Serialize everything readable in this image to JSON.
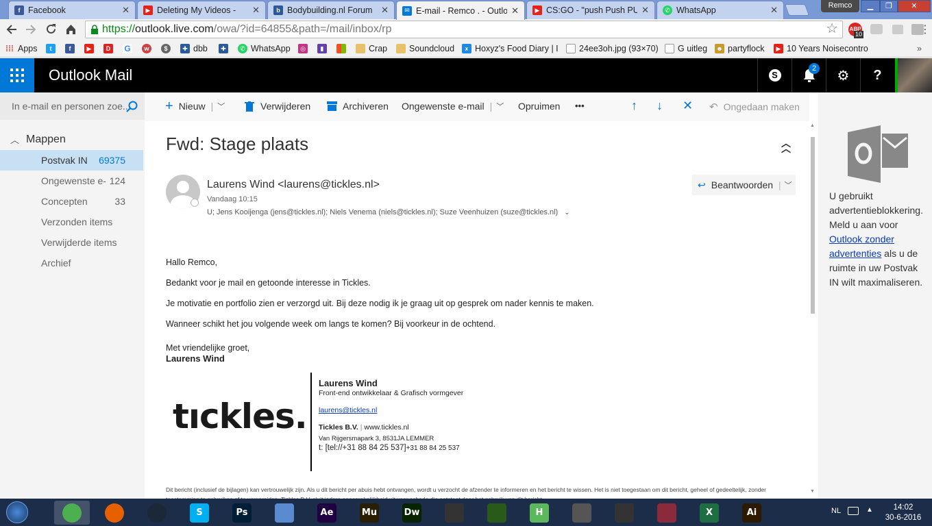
{
  "browser": {
    "tabs": [
      {
        "title": "Facebook",
        "favicon": "facebook-icon",
        "color": "#3b5998",
        "active": false
      },
      {
        "title": "Deleting My Videos -",
        "favicon": "youtube-icon",
        "color": "#e62117",
        "active": false
      },
      {
        "title": "Bodybuilding.nl Forum",
        "favicon": "forum-icon",
        "color": "#2b5a9a",
        "active": false
      },
      {
        "title": "E-mail - Remco . - Outlo",
        "favicon": "outlook-mail-icon",
        "color": "#0078d7",
        "active": true
      },
      {
        "title": "CS:GO - \"push Push PUS",
        "favicon": "youtube-icon",
        "color": "#e62117",
        "active": false
      },
      {
        "title": "WhatsApp",
        "favicon": "whatsapp-icon",
        "color": "#25d366",
        "active": false
      }
    ],
    "profile_name": "Remco",
    "url": {
      "scheme": "https://",
      "host": "outlook.live.com",
      "path": "/owa/?id=64855&path=/mail/inbox/rp"
    },
    "extension_badge": "10",
    "bookmarks": [
      {
        "label": "Apps",
        "icon": "apps-grid-icon",
        "color": "#d44"
      },
      {
        "label": "",
        "icon": "twitter-icon",
        "color": "#1da1f2"
      },
      {
        "label": "",
        "icon": "facebook-icon",
        "color": "#3b5998"
      },
      {
        "label": "",
        "icon": "youtube-icon",
        "color": "#e62117"
      },
      {
        "label": "",
        "icon": "dumpert-icon",
        "color": "#d22"
      },
      {
        "label": "",
        "icon": "google-icon",
        "color": "#4285f4"
      },
      {
        "label": "",
        "icon": "webrtc-icon",
        "color": "#c44"
      },
      {
        "label": "",
        "icon": "bookmark-icon",
        "color": "#666"
      },
      {
        "label": "dbb",
        "icon": "dbb-icon",
        "color": "#2b5a9a"
      },
      {
        "label": "",
        "icon": "dbb2-icon",
        "color": "#2b5a9a"
      },
      {
        "label": "WhatsApp",
        "icon": "whatsapp-icon",
        "color": "#25d366"
      },
      {
        "label": "",
        "icon": "instagram-icon",
        "color": "#c13584"
      },
      {
        "label": "",
        "icon": "twitch-icon",
        "color": "#6441a5"
      },
      {
        "label": "",
        "icon": "microsoft-icon",
        "color": "#f25022"
      },
      {
        "label": "Crap",
        "icon": "folder-icon",
        "color": "#e8c26a"
      },
      {
        "label": "Soundcloud",
        "icon": "folder-icon",
        "color": "#e8c26a"
      },
      {
        "label": "Hoxyz's Food Diary | I",
        "icon": "excel-icon",
        "color": "#1e88e5"
      },
      {
        "label": "24ee3oh.jpg (93×70)",
        "icon": "page-icon",
        "color": "#999"
      },
      {
        "label": "G uitleg",
        "icon": "page-icon",
        "color": "#999"
      },
      {
        "label": "partyflock",
        "icon": "partyflock-icon",
        "color": "#c99a2e"
      },
      {
        "label": "10 Years Noisecontro",
        "icon": "youtube-icon",
        "color": "#e62117"
      }
    ]
  },
  "outlook": {
    "app_title": "Outlook Mail",
    "notification_count": "2",
    "search_placeholder": "In e-mail en personen zoe...",
    "folders_header": "Mappen",
    "folders": [
      {
        "name": "Postvak IN",
        "count": "69375",
        "selected": true
      },
      {
        "name": "Ongewenste e-",
        "count": "124",
        "selected": false
      },
      {
        "name": "Concepten",
        "count": "33",
        "selected": false
      },
      {
        "name": "Verzonden items",
        "count": "",
        "selected": false
      },
      {
        "name": "Verwijderde items",
        "count": "",
        "selected": false
      },
      {
        "name": "Archief",
        "count": "",
        "selected": false
      }
    ],
    "commands": {
      "new": "Nieuw",
      "delete": "Verwijderen",
      "archive": "Archiveren",
      "junk": "Ongewenste e-mail",
      "sweep": "Opruimen",
      "more": "•••",
      "undo": "Ongedaan maken"
    },
    "message": {
      "subject": "Fwd: Stage plaats",
      "sender": "Laurens Wind <laurens@tickles.nl>",
      "date": "Vandaag 10:15",
      "recipients": "U; Jens Kooijenga (jens@tickles.nl); Niels Venema (niels@tickles.nl); Suze Veenhuizen (suze@tickles.nl)",
      "reply": "Beantwoorden",
      "body": [
        "Hallo Remco,",
        "Bedankt voor je mail en getoonde interesse in Tickles.",
        "Je motivatie en portfolio zien er verzorgd uit. Bij deze nodig ik je graag uit op gesprek om nader kennis te maken.",
        "Wanneer schikt het jou volgende week om langs te komen? Bij voorkeur in de ochtend."
      ],
      "closing": "Met vriendelijke groet,",
      "closing_name": "Laurens Wind",
      "logo_text": "tıckles.",
      "signature": {
        "name": "Laurens Wind",
        "role": "Front-end ontwikkelaar & Grafisch vormgever",
        "email": "laurens@tickles.nl",
        "company": "Tickles B.V.",
        "separator": "|",
        "website": "www.tickles.nl",
        "address": "Van Rijgersmapark 3, 8531JA LEMMER",
        "phone_label": "t: [tel://+31 88 84 25 537]",
        "phone": "+31 88 84 25 537"
      },
      "disclaimer": "Dit bericht (inclusief de bijlagen) kan vertrouwelijk zijn. Als u dit bericht per abuis hebt ontvangen, wordt u verzocht de afzender te informeren en het bericht te wissen. Het is niet toegestaan om dit bericht, geheel of gedeeltelijk, zonder toestemming te gebruiken of te verspreiden. Tickles B.V. sluit iedere aansprakelijkheid uit voor schade die ontstaat door het gebruik van dit bericht."
    },
    "ad": {
      "text1": "U gebruikt advertentieblokkering. Meld u aan voor",
      "link": "Outlook zonder advertenties",
      "text2": "als u de ruimte in uw Postvak IN wilt maximaliseren."
    }
  },
  "taskbar": {
    "apps": [
      {
        "name": "chrome",
        "icon": "chrome-icon",
        "color": "#4caf50",
        "label": ""
      },
      {
        "name": "firefox",
        "icon": "firefox-icon",
        "color": "#e66000",
        "label": ""
      },
      {
        "name": "steam",
        "icon": "steam-icon",
        "color": "#1b2838",
        "label": ""
      },
      {
        "name": "skype",
        "icon": "skype-icon",
        "color": "#00aff0",
        "label": "S"
      },
      {
        "name": "photoshop",
        "icon": "photoshop-icon",
        "color": "#001e36",
        "label": "Ps"
      },
      {
        "name": "keyboard",
        "icon": "keyboard-icon",
        "color": "#5a8ad0",
        "label": ""
      },
      {
        "name": "after-effects",
        "icon": "after-effects-icon",
        "color": "#1f0040",
        "label": "Ae"
      },
      {
        "name": "muse",
        "icon": "muse-icon",
        "color": "#2a1f00",
        "label": "Mu"
      },
      {
        "name": "dreamweaver",
        "icon": "dreamweaver-icon",
        "color": "#072401",
        "label": "Dw"
      },
      {
        "name": "video",
        "icon": "film-icon",
        "color": "#333",
        "label": ""
      },
      {
        "name": "notepad",
        "icon": "notepad-icon",
        "color": "#2a5a1a",
        "label": ""
      },
      {
        "name": "h-app",
        "icon": "h-app-icon",
        "color": "#5cb85c",
        "label": "H"
      },
      {
        "name": "display",
        "icon": "display-icon",
        "color": "#555",
        "label": ""
      },
      {
        "name": "racing",
        "icon": "racing-icon",
        "color": "#333",
        "label": ""
      },
      {
        "name": "game",
        "icon": "game-icon",
        "color": "#8a2a3a",
        "label": ""
      },
      {
        "name": "excel",
        "icon": "excel-icon",
        "color": "#1d6f42",
        "label": "X"
      },
      {
        "name": "illustrator",
        "icon": "illustrator-icon",
        "color": "#2e1a00",
        "label": "Ai"
      }
    ],
    "language": "NL",
    "time": "14:02",
    "date": "30-6-2016"
  }
}
